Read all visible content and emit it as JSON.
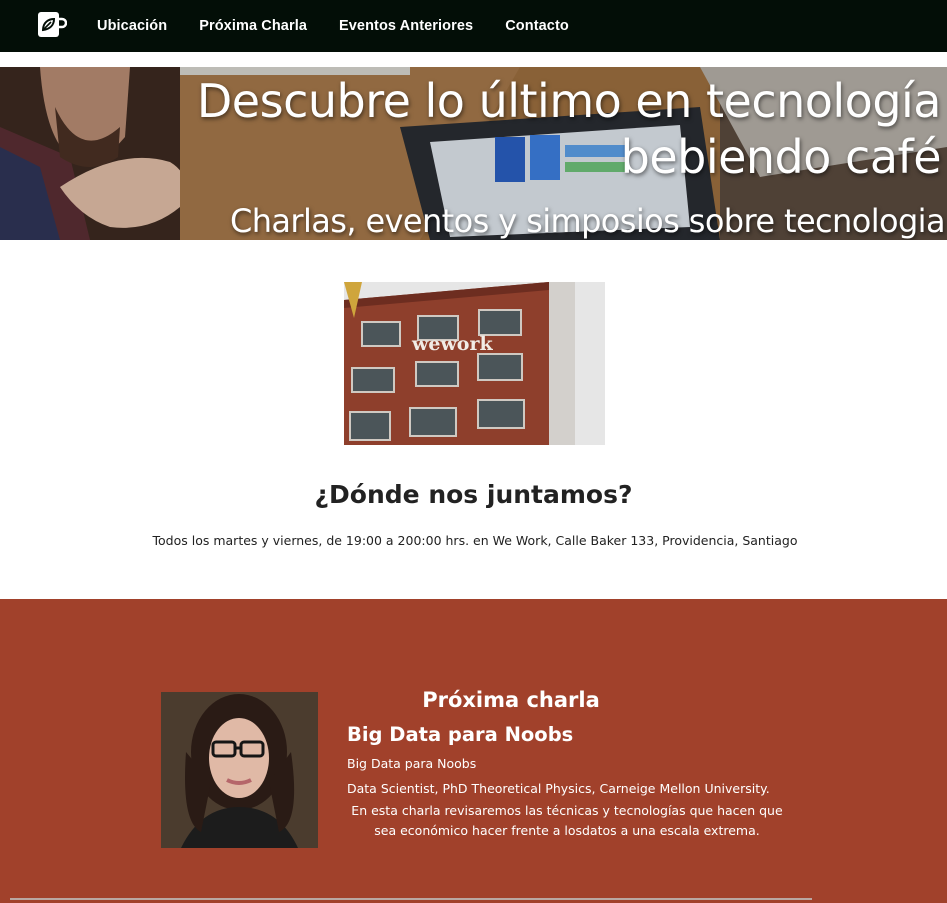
{
  "nav": {
    "brand_icon": "coffee-cup-leaf-icon",
    "links": [
      "Ubicación",
      "Próxima Charla",
      "Eventos Anteriores",
      "Contacto"
    ]
  },
  "hero": {
    "title": "Descubre lo último en tecnología bebiendo café",
    "subtitle": "Charlas, eventos y simposios sobre tecnologia"
  },
  "location": {
    "photo_alt": "wework",
    "heading": "¿Dónde nos juntamos?",
    "text": "Todos los martes y viernes, de 19:00 a 200:00 hrs. en We Work, Calle Baker 133, Providencia, Santiago"
  },
  "next_talk": {
    "heading": "Próxima charla",
    "title": "Big Data para Noobs",
    "subtitle": "Big Data para Noobs",
    "bio": "Data Scientist, PhD Theoretical Physics, Carneige Mellon University.",
    "description": "En esta charla revisaremos las técnicas y tecnologías que hacen que sea económico hacer frente a losdatos a una escala extrema."
  },
  "colors": {
    "navbar": "#030e07",
    "talk_background": "#a1412b",
    "text_on_dark": "#ffffff"
  }
}
